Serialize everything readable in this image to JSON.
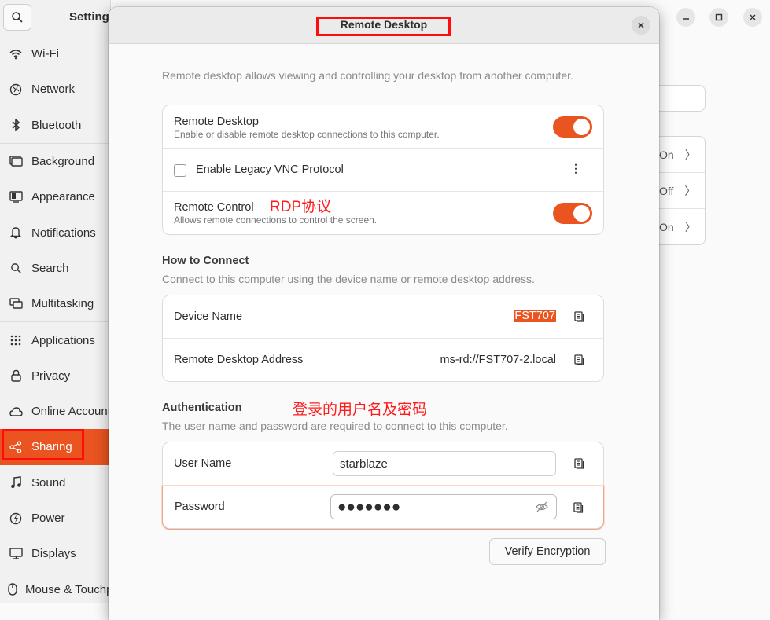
{
  "settings_window": {
    "title": "Settings",
    "sidebar": [
      {
        "label": "Wi-Fi",
        "icon": "wifi-icon"
      },
      {
        "label": "Network",
        "icon": "network-icon"
      },
      {
        "label": "Bluetooth",
        "icon": "bluetooth-icon"
      },
      {
        "label": "Background",
        "icon": "background-icon"
      },
      {
        "label": "Appearance",
        "icon": "appearance-icon"
      },
      {
        "label": "Notifications",
        "icon": "bell-icon"
      },
      {
        "label": "Search",
        "icon": "search-icon"
      },
      {
        "label": "Multitasking",
        "icon": "multitasking-icon"
      },
      {
        "label": "Applications",
        "icon": "apps-grid-icon"
      },
      {
        "label": "Privacy",
        "icon": "lock-icon"
      },
      {
        "label": "Online Accounts",
        "icon": "cloud-icon"
      },
      {
        "label": "Sharing",
        "icon": "share-icon",
        "active": true
      },
      {
        "label": "Sound",
        "icon": "music-note-icon"
      },
      {
        "label": "Power",
        "icon": "power-icon"
      },
      {
        "label": "Displays",
        "icon": "display-icon"
      },
      {
        "label": "Mouse & Touchpad",
        "icon": "mouse-icon"
      }
    ],
    "background_rows": [
      {
        "value": "On"
      },
      {
        "value": "Off"
      },
      {
        "value": "On"
      }
    ]
  },
  "dialog": {
    "title": "Remote Desktop",
    "description": "Remote desktop allows viewing and controlling your desktop from another computer.",
    "remote_desktop": {
      "title": "Remote Desktop",
      "subtitle": "Enable or disable remote desktop connections to this computer.",
      "enabled": true
    },
    "legacy_vnc": {
      "label": "Enable Legacy VNC Protocol",
      "checked": false
    },
    "remote_control": {
      "title": "Remote Control",
      "subtitle": "Allows remote connections to control the screen.",
      "enabled": true
    },
    "how_to_connect": {
      "title": "How to Connect",
      "description": "Connect to this computer using the device name or remote desktop address.",
      "device_name_label": "Device Name",
      "device_name_value": "FST707",
      "address_label": "Remote Desktop Address",
      "address_value": "ms-rd://FST707-2.local"
    },
    "authentication": {
      "title": "Authentication",
      "description": "The user name and password are required to connect to this computer.",
      "username_label": "User Name",
      "username_value": "starblaze",
      "password_label": "Password",
      "password_value": "●●●●●●●"
    },
    "verify_button": "Verify Encryption"
  },
  "annotations": {
    "rdp": "RDP协议",
    "login": "登录的用户名及密码"
  },
  "colors": {
    "accent": "#e95420",
    "highlight": "#ff0d0d"
  }
}
